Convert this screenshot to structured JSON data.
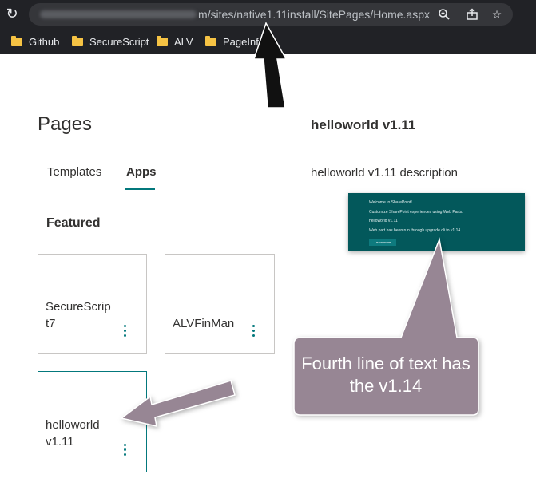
{
  "browser": {
    "url_visible": "m/sites/native1.11install/SitePages/Home.aspx",
    "bookmarks": [
      {
        "label": "Github"
      },
      {
        "label": "SecureScript"
      },
      {
        "label": "ALV"
      },
      {
        "label": "PageInfo"
      }
    ]
  },
  "page": {
    "title": "Pages",
    "tabs": [
      {
        "label": "Templates",
        "active": false
      },
      {
        "label": "Apps",
        "active": true
      }
    ],
    "section": "Featured",
    "cards": [
      {
        "title": "SecureScrip\nt7"
      },
      {
        "title": "ALVFinMan"
      },
      {
        "title": "helloworld\nv1.11",
        "selected": true
      }
    ]
  },
  "detail": {
    "title": "helloworld v1.11",
    "description": "helloworld v1.11 description",
    "preview": {
      "lines": [
        "Welcome to SharePoint!",
        "Customize SharePoint experiences using Web Parts.",
        "helloworld v1.11",
        "Web part has been run through upgrade cli to v1.14"
      ],
      "button": "Learn more"
    }
  },
  "annotation": {
    "callout": "Fourth line of text has the v1.14",
    "callout_color": "#978694"
  },
  "colors": {
    "accent": "#03787c",
    "chrome": "#212226"
  }
}
